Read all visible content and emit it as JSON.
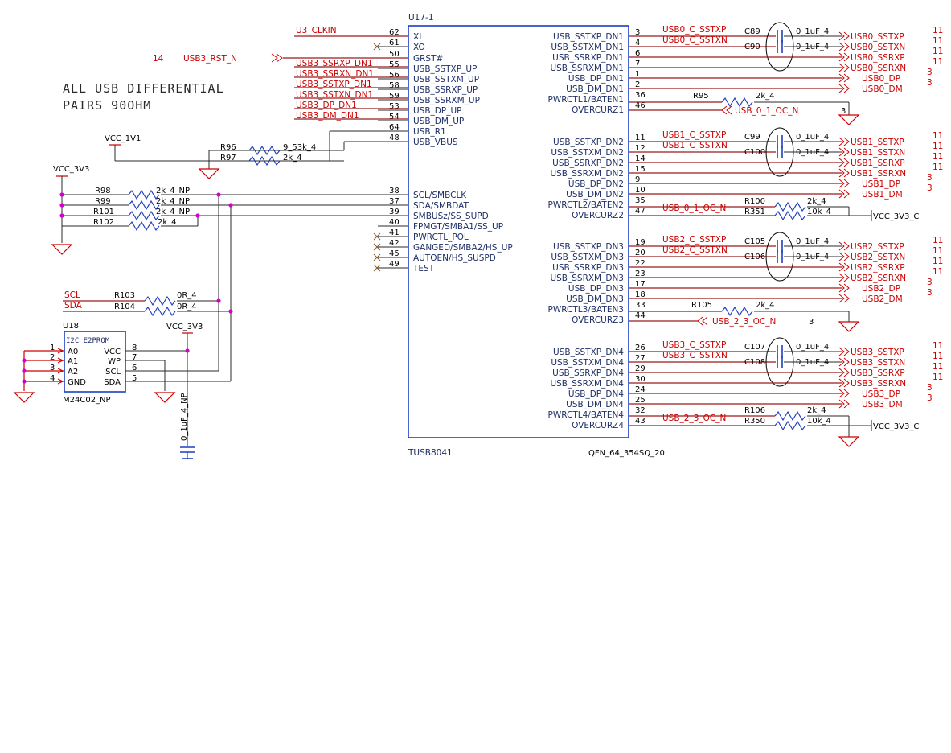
{
  "note": [
    "ALL USB DIFFERENTIAL",
    "PAIRS 90OHM"
  ],
  "ic": {
    "refdes": "U17-1",
    "part": "TUSB8041",
    "package": "QFN_64_354SQ_20",
    "left_pins": [
      {
        "num": "62",
        "name": "XI",
        "nc": false
      },
      {
        "num": "61",
        "name": "XO",
        "nc": true
      },
      {
        "num": "50",
        "name": "GRST#",
        "nc": false
      },
      {
        "num": "55",
        "name": "USB_SSTXP_UP",
        "nc": false
      },
      {
        "num": "56",
        "name": "USB_SSTXM_UP",
        "nc": false
      },
      {
        "num": "58",
        "name": "USB_SSRXP_UP",
        "nc": false
      },
      {
        "num": "59",
        "name": "USB_SSRXM_UP",
        "nc": false
      },
      {
        "num": "53",
        "name": "USB_DP_UP",
        "nc": false
      },
      {
        "num": "54",
        "name": "USB_DM_UP",
        "nc": false
      },
      {
        "num": "64",
        "name": "USB_R1",
        "nc": false
      },
      {
        "num": "48",
        "name": "USB_VBUS",
        "nc": false
      },
      {
        "num": "38",
        "name": "SCL/SMBCLK",
        "nc": false
      },
      {
        "num": "37",
        "name": "SDA/SMBDAT",
        "nc": false
      },
      {
        "num": "39",
        "name": "SMBUSz/SS_SUPD",
        "nc": false
      },
      {
        "num": "40",
        "name": "FPMGT/SMBA1/SS_UP",
        "nc": false
      },
      {
        "num": "41",
        "name": "PWRCTL_POL",
        "nc": true
      },
      {
        "num": "42",
        "name": "GANGED/SMBA2/HS_UP",
        "nc": true
      },
      {
        "num": "45",
        "name": "AUTOEN/HS_SUSPD",
        "nc": true
      },
      {
        "num": "49",
        "name": "TEST",
        "nc": true
      }
    ],
    "right_pins": [
      {
        "num": "3",
        "name": "USB_SSTXP_DN1"
      },
      {
        "num": "4",
        "name": "USB_SSTXM_DN1"
      },
      {
        "num": "6",
        "name": "USB_SSRXP_DN1"
      },
      {
        "num": "7",
        "name": "USB_SSRXM_DN1"
      },
      {
        "num": "1",
        "name": "USB_DP_DN1"
      },
      {
        "num": "2",
        "name": "USB_DM_DN1"
      },
      {
        "num": "36",
        "name": "PWRCTL1/BATEN1"
      },
      {
        "num": "46",
        "name": "OVERCURZ1"
      },
      {
        "num": "11",
        "name": "USB_SSTXP_DN2"
      },
      {
        "num": "12",
        "name": "USB_SSTXM_DN2"
      },
      {
        "num": "14",
        "name": "USB_SSRXP_DN2"
      },
      {
        "num": "15",
        "name": "USB_SSRXM_DN2"
      },
      {
        "num": "9",
        "name": "USB_DP_DN2"
      },
      {
        "num": "10",
        "name": "USB_DM_DN2"
      },
      {
        "num": "35",
        "name": "PWRCTL2/BATEN2"
      },
      {
        "num": "47",
        "name": "OVERCURZ2"
      },
      {
        "num": "19",
        "name": "USB_SSTXP_DN3"
      },
      {
        "num": "20",
        "name": "USB_SSTXM_DN3"
      },
      {
        "num": "22",
        "name": "USB_SSRXP_DN3"
      },
      {
        "num": "23",
        "name": "USB_SSRXM_DN3"
      },
      {
        "num": "17",
        "name": "USB_DP_DN3"
      },
      {
        "num": "18",
        "name": "USB_DM_DN3"
      },
      {
        "num": "33",
        "name": "PWRCTL3/BATEN3"
      },
      {
        "num": "44",
        "name": "OVERCURZ3"
      },
      {
        "num": "26",
        "name": "USB_SSTXP_DN4"
      },
      {
        "num": "27",
        "name": "USB_SSTXM_DN4"
      },
      {
        "num": "29",
        "name": "USB_SSRXP_DN4"
      },
      {
        "num": "30",
        "name": "USB_SSRXM_DN4"
      },
      {
        "num": "24",
        "name": "USB_DP_DN4"
      },
      {
        "num": "25",
        "name": "USB_DM_DN4"
      },
      {
        "num": "32",
        "name": "PWRCTL4/BATEN4"
      },
      {
        "num": "43",
        "name": "OVERCURZ4"
      }
    ]
  },
  "left_nets": {
    "clk": "U3_CLKIN",
    "rst_sheet": "14",
    "rst": "USB3_RST_N",
    "up": [
      "USB3_SSRXP_DN1",
      "USB3_SSRXN_DN1",
      "USB3_SSTXP_DN1",
      "USB3_SSTXN_DN1",
      "USB3_DP_DN1",
      "USB3_DM_DN1"
    ],
    "scl": "SCL",
    "sda": "SDA"
  },
  "power": {
    "vcc_1v1": "VCC_1V1",
    "vcc_3v3_left": "VCC_3V3",
    "vcc_3v3_eeprom": "VCC_3V3",
    "vcc_3v3_c": "VCC_3V3_C"
  },
  "resistors": {
    "R96": {
      "ref": "R96",
      "val": "9_53k_4"
    },
    "R97": {
      "ref": "R97",
      "val": "2k_4"
    },
    "R98": {
      "ref": "R98",
      "val": "2k_4_NP"
    },
    "R99": {
      "ref": "R99",
      "val": "2k_4_NP"
    },
    "R101": {
      "ref": "R101",
      "val": "2k_4_NP"
    },
    "R102": {
      "ref": "R102",
      "val": "2k_4"
    },
    "R103": {
      "ref": "R103",
      "val": "0R_4"
    },
    "R104": {
      "ref": "R104",
      "val": "0R_4"
    },
    "R95": {
      "ref": "R95",
      "val": "2k_4"
    },
    "R100": {
      "ref": "R100",
      "val": "2k_4"
    },
    "R351": {
      "ref": "R351",
      "val": "10k_4"
    },
    "R105": {
      "ref": "R105",
      "val": "2k_4"
    },
    "R106": {
      "ref": "R106",
      "val": "2k_4"
    },
    "R350": {
      "ref": "R350",
      "val": "10k_4"
    }
  },
  "eeprom": {
    "refdes": "U18",
    "title": "I2C_E2PROM",
    "part": "M24C02_NP",
    "left_pins": [
      {
        "num": "1",
        "name": "A0"
      },
      {
        "num": "2",
        "name": "A1"
      },
      {
        "num": "3",
        "name": "A2"
      },
      {
        "num": "4",
        "name": "GND"
      }
    ],
    "right_pins": [
      {
        "num": "8",
        "name": "VCC"
      },
      {
        "num": "7",
        "name": "WP"
      },
      {
        "num": "6",
        "name": "SCL"
      },
      {
        "num": "5",
        "name": "SDA"
      }
    ],
    "decap": "0_1uF_4_NP"
  },
  "ports": [
    {
      "c1": "C89",
      "c2": "C90",
      "n1": "USB0_C_SSTXP",
      "n2": "USB0_C_SSTXN",
      "cval": "0_1uF_4",
      "out": [
        {
          "name": "USB0_SSTXP",
          "sheet": "11"
        },
        {
          "name": "USB0_SSTXN",
          "sheet": "11"
        },
        {
          "name": "USB0_SSRXP",
          "sheet": "11"
        },
        {
          "name": "USB0_SSRXN",
          "sheet": "11"
        },
        {
          "name": "USB0_DP",
          "sheet": "3"
        },
        {
          "name": "USB0_DM",
          "sheet": "3"
        }
      ]
    },
    {
      "c1": "C99",
      "c2": "C100",
      "n1": "USB1_C_SSTXP",
      "n2": "USB1_C_SSTXN",
      "cval": "0_1uF_4",
      "out": [
        {
          "name": "USB1_SSTXP",
          "sheet": "11"
        },
        {
          "name": "USB1_SSTXN",
          "sheet": "11"
        },
        {
          "name": "USB1_SSRXP",
          "sheet": "11"
        },
        {
          "name": "USB1_SSRXN",
          "sheet": "11"
        },
        {
          "name": "USB1_DP",
          "sheet": "3"
        },
        {
          "name": "USB1_DM",
          "sheet": "3"
        }
      ]
    },
    {
      "c1": "C105",
      "c2": "C106",
      "n1": "USB2_C_SSTXP",
      "n2": "USB2_C_SSTXN",
      "cval": "0_1uF_4",
      "out": [
        {
          "name": "USB2_SSTXP",
          "sheet": "11"
        },
        {
          "name": "USB2_SSTXN",
          "sheet": "11"
        },
        {
          "name": "USB2_SSRXP",
          "sheet": "11"
        },
        {
          "name": "USB2_SSRXN",
          "sheet": "11"
        },
        {
          "name": "USB2_DP",
          "sheet": "3"
        },
        {
          "name": "USB2_DM",
          "sheet": "3"
        }
      ]
    },
    {
      "c1": "C107",
      "c2": "C108",
      "n1": "USB3_C_SSTXP",
      "n2": "USB3_C_SSTXN",
      "cval": "0_1uF_4",
      "out": [
        {
          "name": "USB3_SSTXP",
          "sheet": "11"
        },
        {
          "name": "USB3_SSTXN",
          "sheet": "11"
        },
        {
          "name": "USB3_SSRXP",
          "sheet": "11"
        },
        {
          "name": "USB3_SSRXN",
          "sheet": "11"
        },
        {
          "name": "USB3_DP",
          "sheet": "3"
        },
        {
          "name": "USB3_DM",
          "sheet": "3"
        }
      ]
    }
  ],
  "oc": {
    "oc01_out": "USB_0_1_OC_N",
    "oc01_out_sheet": "3",
    "oc01_in": "USB_0_1_OC_N",
    "oc23_out": "USB_2_3_OC_N",
    "oc23_out_sheet": "3",
    "oc23_in": "USB_2_3_OC_N"
  }
}
